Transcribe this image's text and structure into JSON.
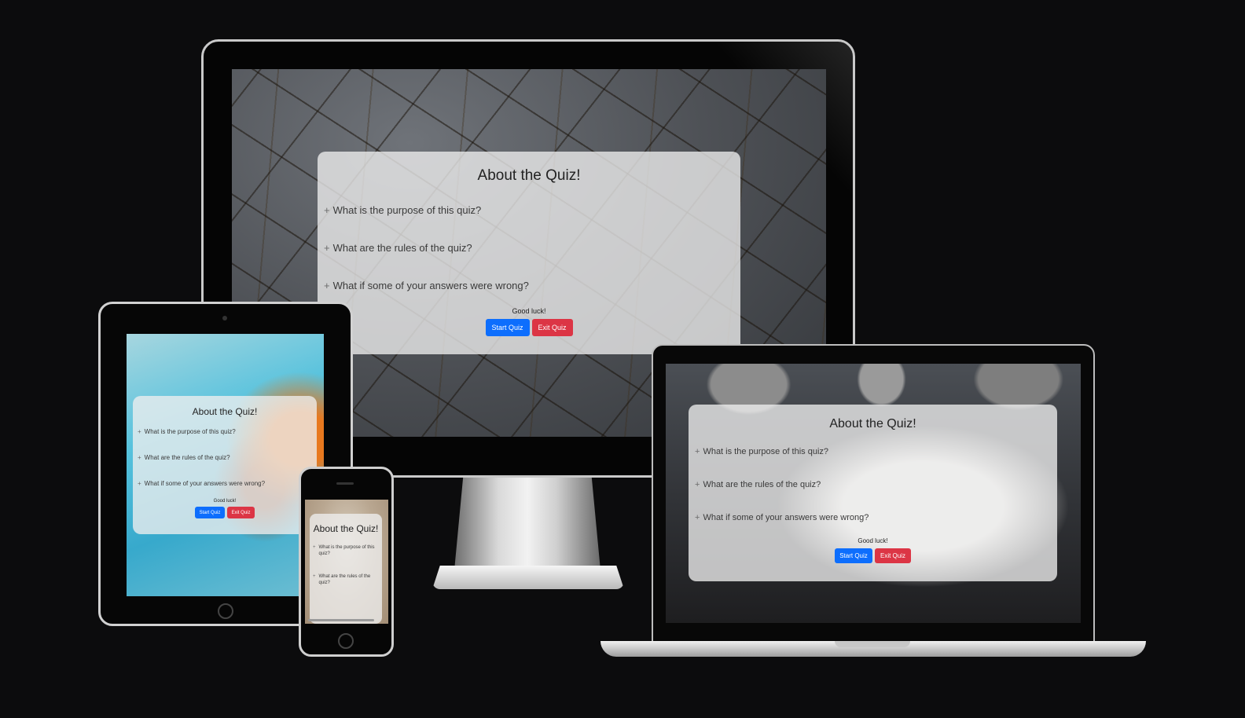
{
  "monitor": {
    "title": "About the Quiz!",
    "faq": [
      "What is the purpose of this quiz?",
      "What are the rules of the quiz?",
      "What if some of your answers were wrong?"
    ],
    "good_luck": "Good luck!",
    "start_label": "Start Quiz",
    "exit_label": "Exit Quiz"
  },
  "laptop": {
    "title": "About the Quiz!",
    "faq": [
      "What is the purpose of this quiz?",
      "What are the rules of the quiz?",
      "What if some of your answers were wrong?"
    ],
    "good_luck": "Good luck!",
    "start_label": "Start Quiz",
    "exit_label": "Exit Quiz"
  },
  "tablet": {
    "title": "About the Quiz!",
    "faq": [
      "What is the purpose of this quiz?",
      "What are the rules of the quiz?",
      "What if some of your answers were wrong?"
    ],
    "good_luck": "Good luck!",
    "start_label": "Start Quiz",
    "exit_label": "Exit Quiz"
  },
  "phone": {
    "title": "About the Quiz!",
    "faq": [
      "What is the purpose of this quiz?",
      "What are the rules of the quiz?"
    ]
  },
  "colors": {
    "start_button": "#0d6efd",
    "exit_button": "#dc3545",
    "page_background": "#0c0c0d"
  }
}
